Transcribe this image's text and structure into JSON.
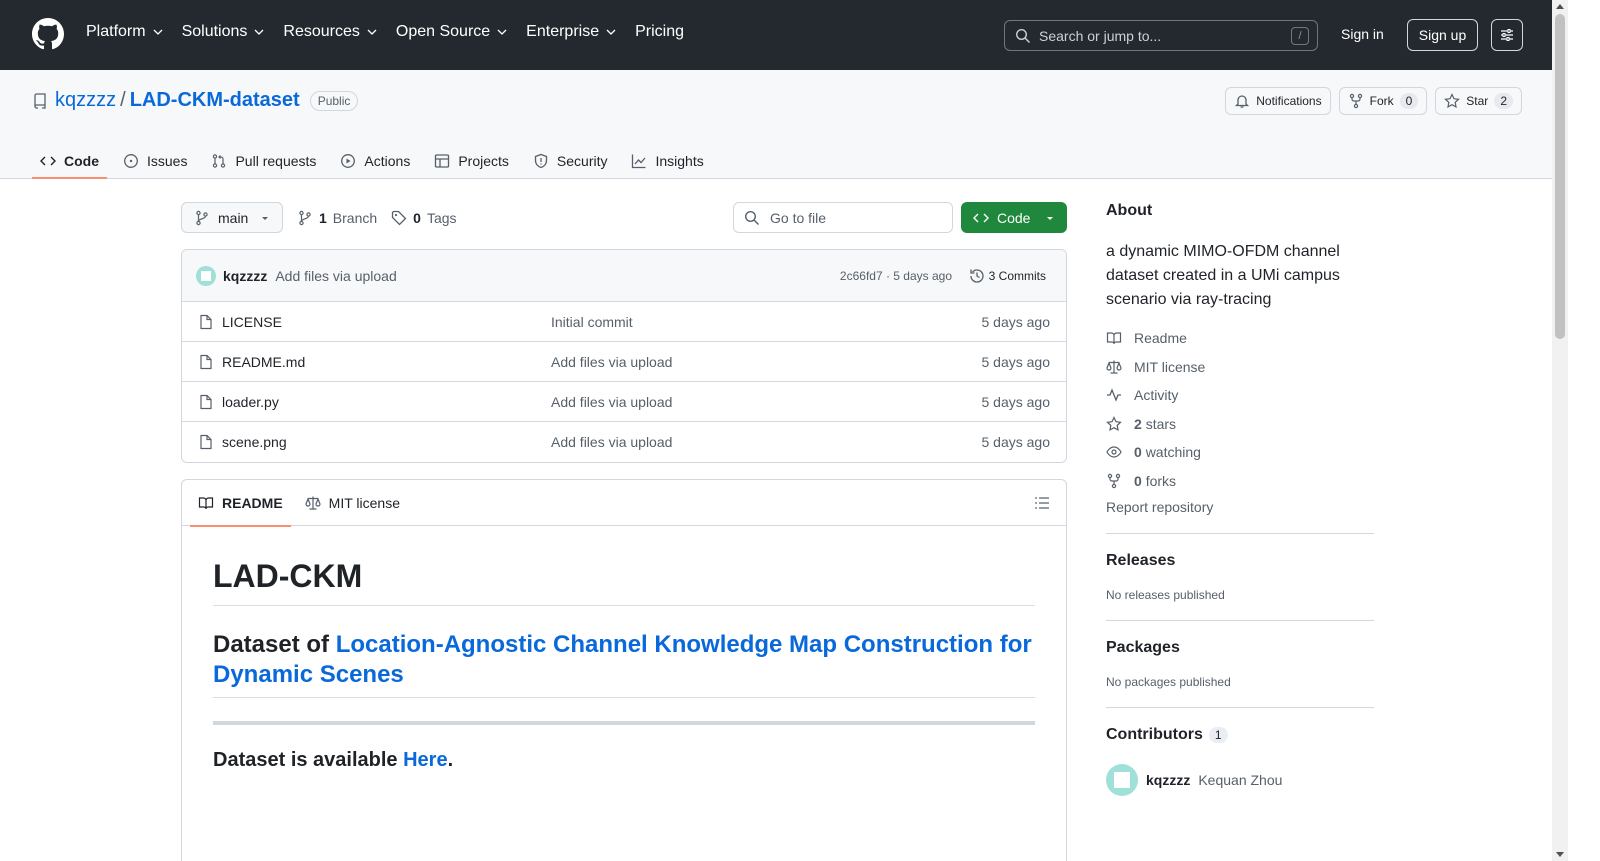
{
  "nav": {
    "items": [
      "Platform",
      "Solutions",
      "Resources",
      "Open Source",
      "Enterprise"
    ],
    "pricing": "Pricing",
    "search_placeholder": "Search or jump to...",
    "search_shortcut": "/",
    "sign_in": "Sign in",
    "sign_up": "Sign up"
  },
  "repo": {
    "owner": "kqzzzz",
    "separator": "/",
    "name": "LAD-CKM-dataset",
    "visibility": "Public",
    "notifications_label": "Notifications",
    "fork_label": "Fork",
    "fork_count": "0",
    "star_label": "Star",
    "star_count": "2",
    "tabs": [
      "Code",
      "Issues",
      "Pull requests",
      "Actions",
      "Projects",
      "Security",
      "Insights"
    ]
  },
  "toolbar": {
    "branch": "main",
    "branch_count": "1",
    "branch_label": "Branch",
    "tag_count": "0",
    "tag_label": "Tags",
    "go_to_file": "Go to file",
    "code_button": "Code"
  },
  "commit": {
    "user": "kqzzzz",
    "message": "Add files via upload",
    "meta": "2c66fd7 · 5 days ago",
    "count": "3 Commits"
  },
  "files": [
    {
      "name": "LICENSE",
      "message": "Initial commit",
      "age": "5 days ago"
    },
    {
      "name": "README.md",
      "message": "Add files via upload",
      "age": "5 days ago"
    },
    {
      "name": "loader.py",
      "message": "Add files via upload",
      "age": "5 days ago"
    },
    {
      "name": "scene.png",
      "message": "Add files via upload",
      "age": "5 days ago"
    }
  ],
  "readme": {
    "tab_readme": "README",
    "tab_license": "MIT license",
    "h1": "LAD-CKM",
    "h2_prefix": "Dataset of ",
    "h2_link": "Location-Agnostic Channel Knowledge Map Construction for Dynamic Scenes",
    "h3_prefix": "Dataset is available ",
    "h3_link": "Here",
    "h3_suffix": "."
  },
  "about": {
    "title": "About",
    "description": "a dynamic MIMO-OFDM channel dataset created in a UMi campus scenario via ray-tracing",
    "readme": "Readme",
    "license": "MIT license",
    "activity": "Activity",
    "stars_count": "2",
    "stars_label": "stars",
    "watching_count": "0",
    "watching_label": "watching",
    "forks_count": "0",
    "forks_label": "forks",
    "report": "Report repository"
  },
  "releases": {
    "title": "Releases",
    "text": "No releases published"
  },
  "packages": {
    "title": "Packages",
    "text": "No packages published"
  },
  "contributors": {
    "title": "Contributors",
    "count": "1",
    "user": "kqzzzz",
    "full_name": "Kequan Zhou"
  }
}
